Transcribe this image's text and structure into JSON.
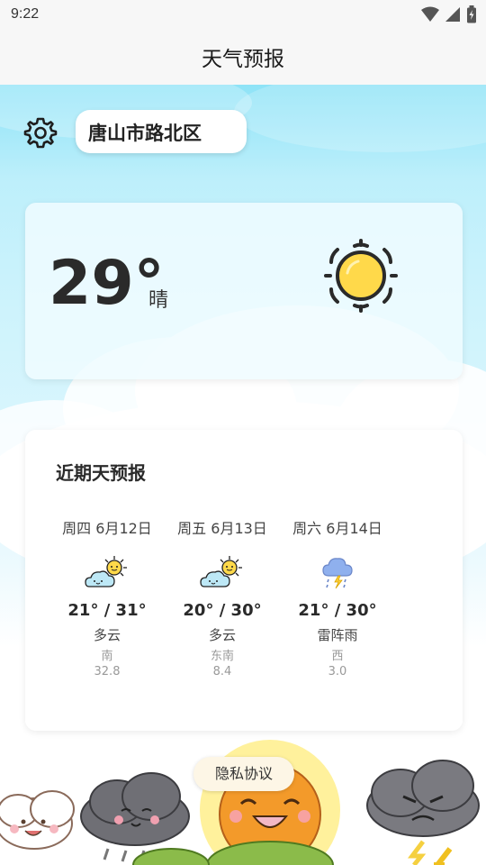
{
  "status_bar": {
    "time": "9:22",
    "icons": [
      "wifi-icon",
      "signal-icon",
      "battery-icon"
    ]
  },
  "app_bar": {
    "title": "天气预报"
  },
  "location": {
    "settings_icon": "gear-icon",
    "city": "唐山市路北区"
  },
  "current": {
    "temperature": "29°",
    "condition": "晴",
    "icon": "sun-icon"
  },
  "forecast": {
    "title": "近期天预报",
    "days": [
      {
        "date": "周四 6月12日",
        "icon": "partly-cloudy-icon",
        "temp": "21° / 31°",
        "desc": "多云",
        "wind_dir": "南",
        "wind_speed": "32.8"
      },
      {
        "date": "周五 6月13日",
        "icon": "partly-cloudy-icon",
        "temp": "20° / 30°",
        "desc": "多云",
        "wind_dir": "东南",
        "wind_speed": "8.4"
      },
      {
        "date": "周六 6月14日",
        "icon": "thunder-rain-icon",
        "temp": "21° / 30°",
        "desc": "雷阵雨",
        "wind_dir": "西",
        "wind_speed": "3.0"
      }
    ]
  },
  "footer": {
    "privacy_label": "隐私协议"
  },
  "colors": {
    "sky_top": "#8ee3f7",
    "sun_yellow": "#ffd94a",
    "card_bg": "#f0fbff",
    "privacy_bg": "#fdf6e6"
  }
}
